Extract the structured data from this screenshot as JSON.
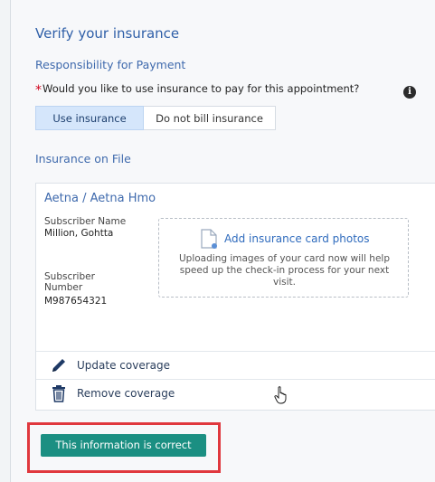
{
  "header": {
    "title": "Verify your insurance",
    "subtitle": "Responsibility for Payment"
  },
  "question": {
    "required_marker": "*",
    "text": "Would you like to use insurance to pay for this appointment?",
    "info_icon": "info-icon"
  },
  "billing_toggle": {
    "options": [
      {
        "label": "Use insurance",
        "selected": true
      },
      {
        "label": "Do not bill insurance",
        "selected": false
      }
    ]
  },
  "insurance_section": {
    "title": "Insurance on File"
  },
  "coverage_card": {
    "plan_name": "Aetna / Aetna Hmo",
    "subscriber_name_label": "Subscriber Name",
    "subscriber_name_value": "Million, Gohtta",
    "subscriber_number_label_line1": "Subscriber",
    "subscriber_number_label_line2": "Number",
    "subscriber_number_value": "M987654321",
    "upload": {
      "link_label": "Add insurance card photos",
      "help_line1": "Uploading images of your card now will help",
      "help_line2": "speed up the check-in process for your next",
      "help_line3": "visit."
    },
    "actions": [
      {
        "label": "Update coverage",
        "icon": "pencil-icon"
      },
      {
        "label": "Remove coverage",
        "icon": "trash-icon"
      }
    ]
  },
  "footer": {
    "confirm_label": "This information is correct"
  },
  "colors": {
    "accent_blue": "#2f5fa8",
    "selected_bg": "#d5e6fb",
    "confirm_green": "#1b8f82",
    "highlight_red": "#e0383e",
    "required_red": "#d0021b"
  }
}
